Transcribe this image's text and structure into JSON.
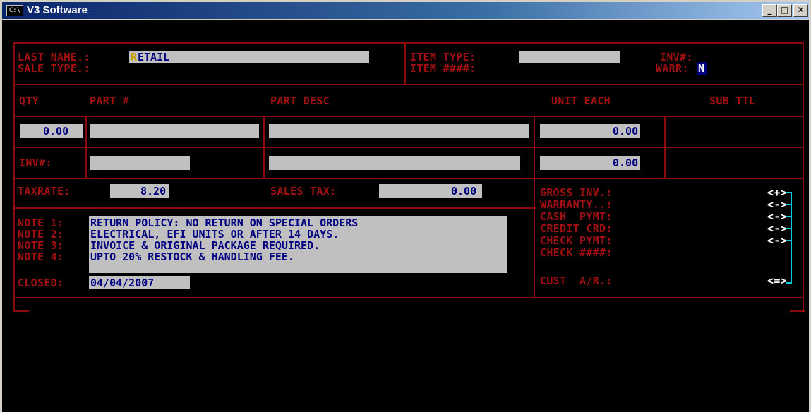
{
  "window": {
    "title": "V3 Software",
    "icon_text": "C:\\",
    "min": "_",
    "max": "□",
    "close": "✕"
  },
  "header": {
    "last_name_label": "LAST NAME.:",
    "last_name_first": "R",
    "last_name_rest": "ETAIL",
    "sale_type_label": "SALE TYPE.:",
    "item_type_label": "ITEM TYPE:",
    "item_num_label": "ITEM ####:",
    "inv_label": "INV#:",
    "warr_label": "WARR:",
    "warr_value": "N"
  },
  "columns": {
    "qty": "QTY",
    "part": "PART #",
    "desc": "PART DESC",
    "unit": "UNIT EACH",
    "sub": "SUB TTL"
  },
  "line1": {
    "qty": "0.00",
    "unit": "0.00"
  },
  "line2": {
    "inv_label": "INV#:",
    "unit": "0.00"
  },
  "tax": {
    "rate_label": "TAXRATE:",
    "rate": "8.20",
    "sales_tax_label": "SALES TAX:",
    "sales_tax": "0.00"
  },
  "notes": [
    {
      "label": "NOTE 1:",
      "text": "RETURN POLICY: NO RETURN ON SPECIAL ORDERS"
    },
    {
      "label": "NOTE 2:",
      "text": "ELECTRICAL, EFI UNITS OR AFTER 14 DAYS.   "
    },
    {
      "label": "NOTE 3:",
      "text": "INVOICE & ORIGINAL PACKAGE REQUIRED.      "
    },
    {
      "label": "NOTE 4:",
      "text": "UPTO 20% RESTOCK & HANDLING FEE.          "
    }
  ],
  "closed": {
    "label": "CLOSED:",
    "value": "04/04/2007"
  },
  "totals": [
    {
      "label": "GROSS INV.:",
      "sign": "<+>"
    },
    {
      "label": "WARRANTY..:",
      "sign": "<->"
    },
    {
      "label": "CASH  PYMT:",
      "sign": "<->"
    },
    {
      "label": "CREDIT CRD:",
      "sign": "<->"
    },
    {
      "label": "CHECK PYMT:",
      "sign": "<->"
    },
    {
      "label": "CHECK ####:",
      "sign": ""
    },
    {
      "label": "CUST  A/R.:",
      "sign": "<=>"
    }
  ]
}
